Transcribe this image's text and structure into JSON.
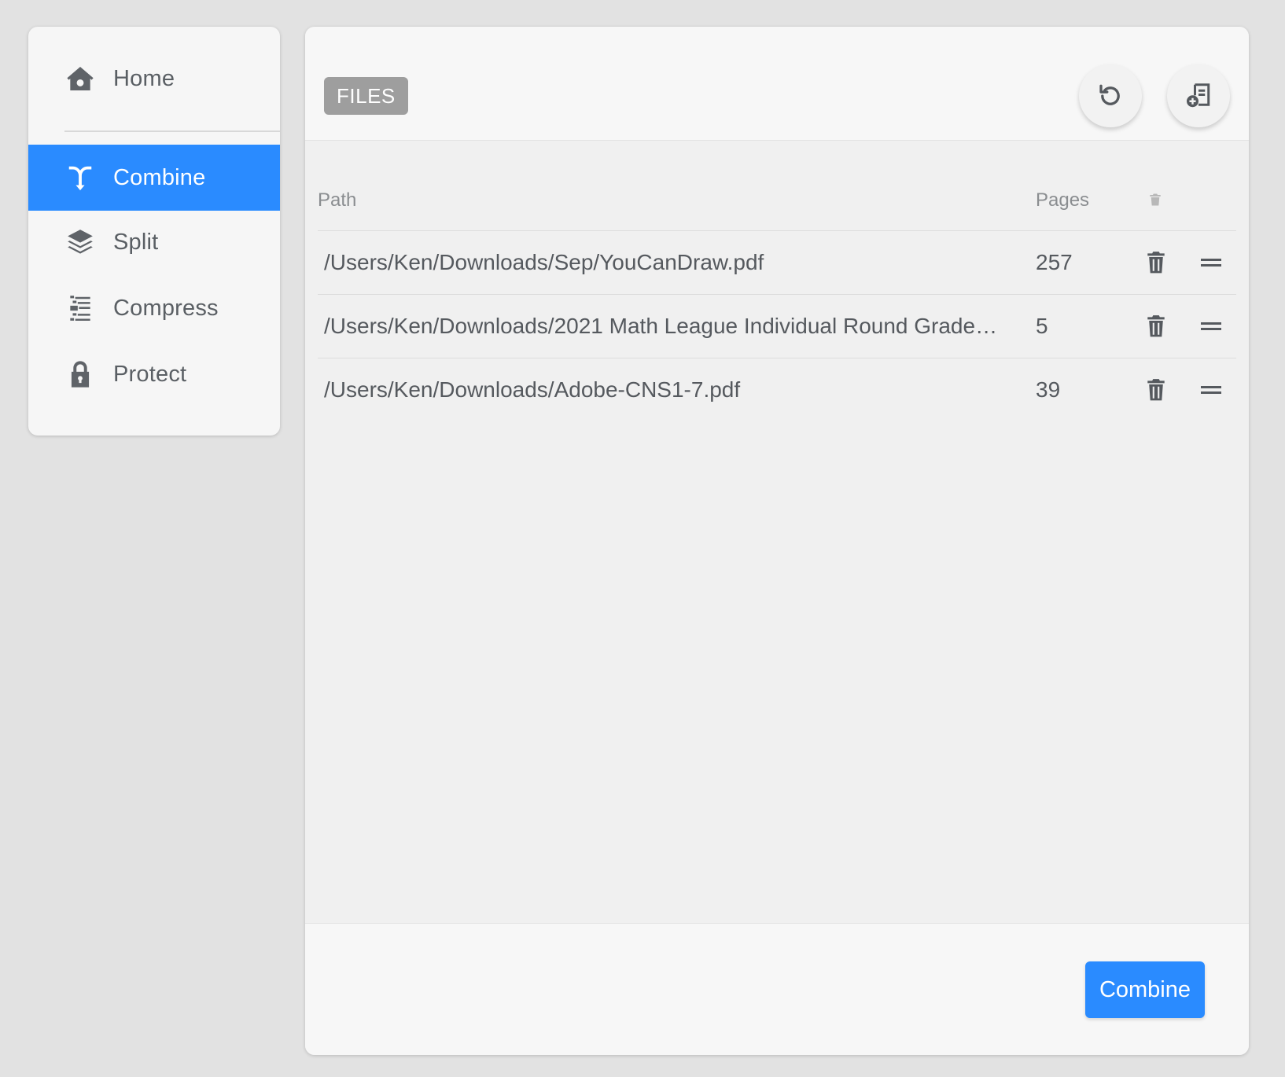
{
  "sidebar": {
    "items": [
      {
        "label": "Home",
        "icon": "home-icon"
      },
      {
        "label": "Combine",
        "icon": "combine-icon",
        "active": true
      },
      {
        "label": "Split",
        "icon": "layers-icon"
      },
      {
        "label": "Compress",
        "icon": "compress-icon"
      },
      {
        "label": "Protect",
        "icon": "lock-icon"
      }
    ]
  },
  "header": {
    "badge": "FILES",
    "buttons": [
      {
        "icon": "reset-icon"
      },
      {
        "icon": "add-file-icon"
      }
    ]
  },
  "table": {
    "columns": [
      "Path",
      "Pages",
      ""
    ],
    "rows": [
      {
        "path": "/Users/Ken/Downloads/Sep/YouCanDraw.pdf",
        "pages": "257"
      },
      {
        "path": "/Users/Ken/Downloads/2021 Math League Individual Round Grade…",
        "pages": "5"
      },
      {
        "path": "/Users/Ken/Downloads/Adobe-CNS1-7.pdf",
        "pages": "39"
      }
    ]
  },
  "footer": {
    "action_label": "Combine"
  },
  "colors": {
    "accent": "#2a8bff",
    "badge": "#9e9e9e",
    "background": "#e2e2e2"
  }
}
